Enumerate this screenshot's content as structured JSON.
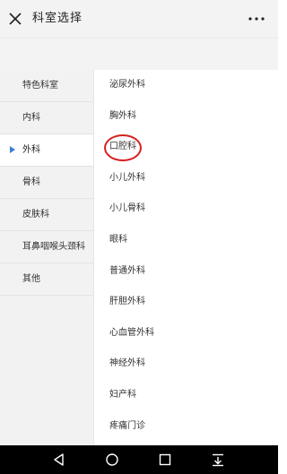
{
  "header": {
    "title": "科室选择",
    "close_icon": "close-icon",
    "more_icon": "more-icon"
  },
  "sidebar": {
    "items": [
      {
        "label": "特色科室",
        "active": false
      },
      {
        "label": "内科",
        "active": false
      },
      {
        "label": "外科",
        "active": true
      },
      {
        "label": "骨科",
        "active": false
      },
      {
        "label": "皮肤科",
        "active": false
      },
      {
        "label": "耳鼻咽喉头颈科",
        "active": false
      },
      {
        "label": "其他",
        "active": false
      }
    ]
  },
  "departments": {
    "items": [
      {
        "label": "泌尿外科"
      },
      {
        "label": "胸外科"
      },
      {
        "label": "口腔科"
      },
      {
        "label": "小儿外科"
      },
      {
        "label": "小儿骨科"
      },
      {
        "label": "眼科"
      },
      {
        "label": "普通外科"
      },
      {
        "label": "肝胆外科"
      },
      {
        "label": "心血管外科"
      },
      {
        "label": "神经外科"
      },
      {
        "label": "妇产科"
      },
      {
        "label": "疼痛门诊"
      }
    ]
  },
  "navbar": {
    "buttons": [
      "back-icon",
      "home-icon",
      "recents-icon",
      "notification-drawer-icon"
    ]
  },
  "colors": {
    "accent": "#3b7fd4",
    "highlight_circle": "#d71f1f",
    "sidebar_bg": "#f2f2f2",
    "header_bg": "#f3f3f3"
  }
}
